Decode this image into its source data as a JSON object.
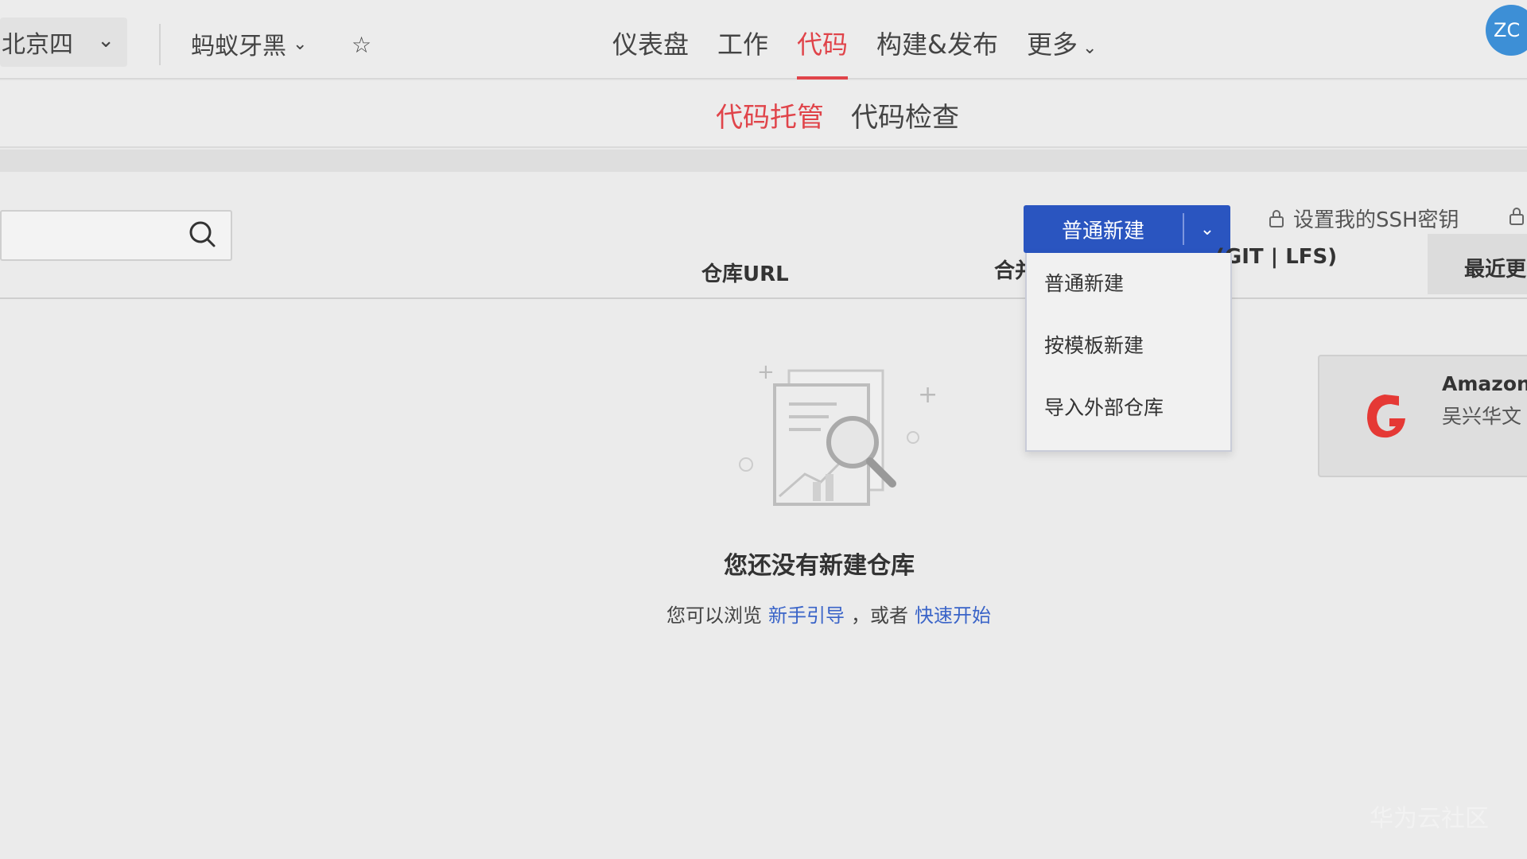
{
  "topbar": {
    "region": "北京四",
    "project": "蚂蚁牙黑",
    "nav": [
      {
        "label": "仪表盘",
        "active": false
      },
      {
        "label": "工作",
        "active": false
      },
      {
        "label": "代码",
        "active": true
      },
      {
        "label": "构建&发布",
        "active": false
      },
      {
        "label": "更多",
        "active": false
      }
    ],
    "avatar_text": "ZC"
  },
  "subnav": [
    {
      "label": "代码托管",
      "active": true
    },
    {
      "label": "代码检查",
      "active": false
    }
  ],
  "toolbar": {
    "new_button_label": "普通新建",
    "ssh_label": "设置我的SSH密钥"
  },
  "dropdown_menu": [
    "普通新建",
    "按模板新建",
    "导入外部仓库"
  ],
  "table": {
    "col_url": "仓库URL",
    "col_merge": "合并",
    "col_capacity": "(GIT | LFS)",
    "col_recent": "最近更"
  },
  "side_card": {
    "name": "Amazon",
    "font": "吴兴华文"
  },
  "empty_state": {
    "title": "您还没有新建仓库",
    "prefix": "您可以浏览",
    "link1": "新手引导",
    "middle": "，或者",
    "link2": "快速开始"
  },
  "watermark": "华为云社区",
  "colors": {
    "accent": "#e0444a",
    "primary_button": "#2a55c0",
    "link": "#3a64c8"
  }
}
